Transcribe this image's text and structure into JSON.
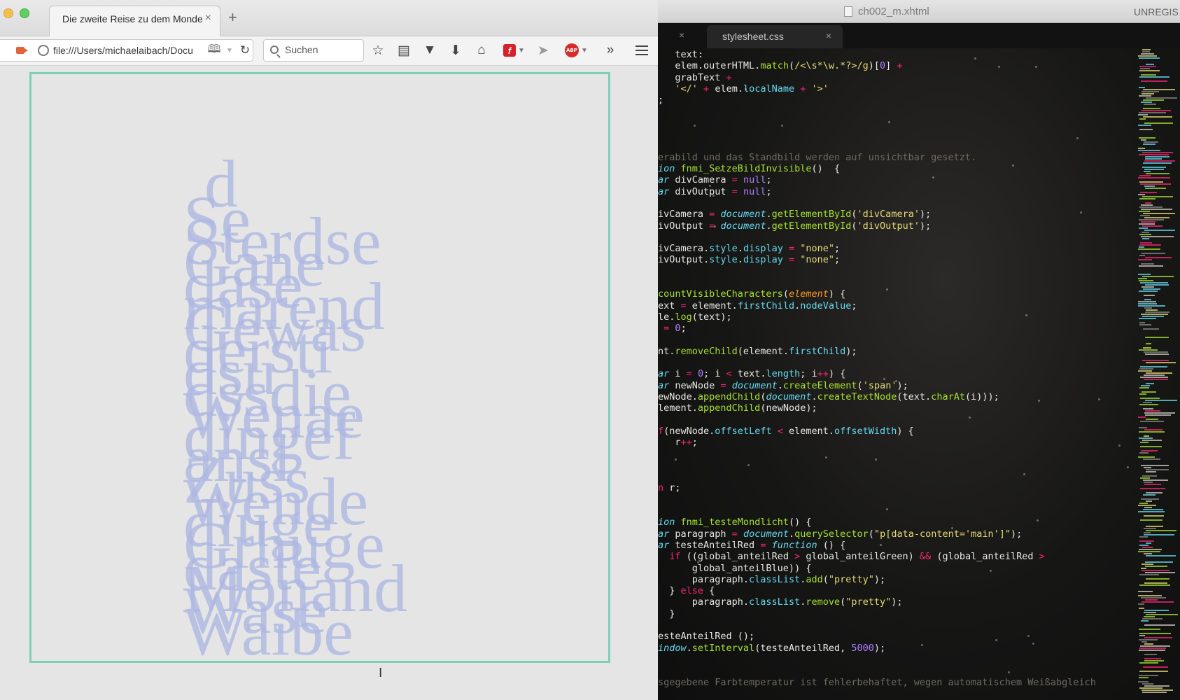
{
  "browser": {
    "tab_title": "Die zweite Reise zu dem Monde",
    "tab_close": "×",
    "new_tab": "+",
    "url": "file:///Users/michaelaibach/Docu",
    "search_placeholder": "Suchen",
    "toolbar_more": "»",
    "flash_letter": "f",
    "abp_label": "ABP",
    "text_cursor": "I"
  },
  "page": {
    "words": [
      "d",
      "Se",
      "Sterdse",
      "Gane",
      "dase",
      "marend",
      "Gewas",
      "dersti",
      "dsu",
      "dssdie",
      "Wenae",
      "dingef",
      "ansl",
      "Zuss",
      "Wende",
      "diuge",
      "Grhuge",
      "daste",
      "Monand",
      "Wase",
      "Waibe"
    ],
    "accent_color": "#7fcfb8",
    "text_color": "#adb7e2"
  },
  "editor": {
    "window_title": "ch002_m.xhtml",
    "unregistered": "UNREGIS",
    "tab_close_first": "×",
    "tab_title": "stylesheet.css",
    "tab_close": "×",
    "code_lines": [
      [
        {
          "t": "c-pl",
          "s": "   text:"
        }
      ],
      [
        {
          "t": "c-pl",
          "s": "   elem.outerHTML."
        },
        {
          "t": "c-fn",
          "s": "match"
        },
        {
          "t": "c-pl",
          "s": "("
        },
        {
          "t": "c-str",
          "s": "/<\\s*\\w.*?>/g"
        },
        {
          "t": "c-pl",
          "s": ")["
        },
        {
          "t": "c-num",
          "s": "0"
        },
        {
          "t": "c-pl",
          "s": "] "
        },
        {
          "t": "c-op",
          "s": "+"
        }
      ],
      [
        {
          "t": "c-pl",
          "s": "   grabText "
        },
        {
          "t": "c-op",
          "s": "+"
        }
      ],
      [
        {
          "t": "c-pl",
          "s": "   "
        },
        {
          "t": "c-str",
          "s": "'</'"
        },
        {
          "t": "c-pl",
          "s": " "
        },
        {
          "t": "c-op",
          "s": "+"
        },
        {
          "t": "c-pl",
          "s": " elem."
        },
        {
          "t": "c-prop",
          "s": "localName"
        },
        {
          "t": "c-pl",
          "s": " "
        },
        {
          "t": "c-op",
          "s": "+"
        },
        {
          "t": "c-pl",
          "s": " "
        },
        {
          "t": "c-str",
          "s": "'>'"
        }
      ],
      [
        {
          "t": "c-pl",
          "s": ";"
        }
      ],
      [
        {
          "t": "c-pl",
          "s": ""
        }
      ],
      [
        {
          "t": "c-pl",
          "s": ""
        }
      ],
      [
        {
          "t": "c-pl",
          "s": ""
        }
      ],
      [
        {
          "t": "c-pl",
          "s": ""
        }
      ],
      [
        {
          "t": "c-com",
          "s": "erabild und das Standbild werden auf unsichtbar gesetzt."
        }
      ],
      [
        {
          "t": "c-kw",
          "s": "ion"
        },
        {
          "t": "c-pl",
          "s": " "
        },
        {
          "t": "c-fn",
          "s": "fnmi_SetzeBildInvisible"
        },
        {
          "t": "c-pl",
          "s": "()  {"
        }
      ],
      [
        {
          "t": "c-kw",
          "s": "ar"
        },
        {
          "t": "c-pl",
          "s": " divCamera "
        },
        {
          "t": "c-op",
          "s": "="
        },
        {
          "t": "c-pl",
          "s": " "
        },
        {
          "t": "c-num",
          "s": "null"
        },
        {
          "t": "c-pl",
          "s": ";"
        }
      ],
      [
        {
          "t": "c-kw",
          "s": "ar"
        },
        {
          "t": "c-pl",
          "s": " divOutput "
        },
        {
          "t": "c-op",
          "s": "="
        },
        {
          "t": "c-pl",
          "s": " "
        },
        {
          "t": "c-num",
          "s": "null"
        },
        {
          "t": "c-pl",
          "s": ";"
        }
      ],
      [
        {
          "t": "c-pl",
          "s": ""
        }
      ],
      [
        {
          "t": "c-pl",
          "s": "ivCamera "
        },
        {
          "t": "c-op",
          "s": "="
        },
        {
          "t": "c-pl",
          "s": " "
        },
        {
          "t": "c-kw",
          "s": "document"
        },
        {
          "t": "c-pl",
          "s": "."
        },
        {
          "t": "c-fn",
          "s": "getElementById"
        },
        {
          "t": "c-pl",
          "s": "("
        },
        {
          "t": "c-str",
          "s": "'divCamera'"
        },
        {
          "t": "c-pl",
          "s": ");"
        }
      ],
      [
        {
          "t": "c-pl",
          "s": "ivOutput "
        },
        {
          "t": "c-op",
          "s": "="
        },
        {
          "t": "c-pl",
          "s": " "
        },
        {
          "t": "c-kw",
          "s": "document"
        },
        {
          "t": "c-pl",
          "s": "."
        },
        {
          "t": "c-fn",
          "s": "getElementById"
        },
        {
          "t": "c-pl",
          "s": "("
        },
        {
          "t": "c-str",
          "s": "'divOutput'"
        },
        {
          "t": "c-pl",
          "s": ");"
        }
      ],
      [
        {
          "t": "c-pl",
          "s": ""
        }
      ],
      [
        {
          "t": "c-pl",
          "s": "ivCamera."
        },
        {
          "t": "c-prop",
          "s": "style"
        },
        {
          "t": "c-pl",
          "s": "."
        },
        {
          "t": "c-prop",
          "s": "display"
        },
        {
          "t": "c-pl",
          "s": " "
        },
        {
          "t": "c-op",
          "s": "="
        },
        {
          "t": "c-pl",
          "s": " "
        },
        {
          "t": "c-str",
          "s": "\"none\""
        },
        {
          "t": "c-pl",
          "s": ";"
        }
      ],
      [
        {
          "t": "c-pl",
          "s": "ivOutput."
        },
        {
          "t": "c-prop",
          "s": "style"
        },
        {
          "t": "c-pl",
          "s": "."
        },
        {
          "t": "c-prop",
          "s": "display"
        },
        {
          "t": "c-pl",
          "s": " "
        },
        {
          "t": "c-op",
          "s": "="
        },
        {
          "t": "c-pl",
          "s": " "
        },
        {
          "t": "c-str",
          "s": "\"none\""
        },
        {
          "t": "c-pl",
          "s": ";"
        }
      ],
      [
        {
          "t": "c-pl",
          "s": ""
        }
      ],
      [
        {
          "t": "c-pl",
          "s": ""
        }
      ],
      [
        {
          "t": "c-fn",
          "s": "countVisibleCharacters"
        },
        {
          "t": "c-pl",
          "s": "("
        },
        {
          "t": "c-arg",
          "s": "element"
        },
        {
          "t": "c-pl",
          "s": ") {"
        }
      ],
      [
        {
          "t": "c-pl",
          "s": "ext "
        },
        {
          "t": "c-op",
          "s": "="
        },
        {
          "t": "c-pl",
          "s": " element."
        },
        {
          "t": "c-prop",
          "s": "firstChild"
        },
        {
          "t": "c-pl",
          "s": "."
        },
        {
          "t": "c-prop",
          "s": "nodeValue"
        },
        {
          "t": "c-pl",
          "s": ";"
        }
      ],
      [
        {
          "t": "c-pl",
          "s": "le."
        },
        {
          "t": "c-fn",
          "s": "log"
        },
        {
          "t": "c-pl",
          "s": "(text);"
        }
      ],
      [
        {
          "t": "c-pl",
          "s": " "
        },
        {
          "t": "c-op",
          "s": "="
        },
        {
          "t": "c-pl",
          "s": " "
        },
        {
          "t": "c-num",
          "s": "0"
        },
        {
          "t": "c-pl",
          "s": ";"
        }
      ],
      [
        {
          "t": "c-pl",
          "s": ""
        }
      ],
      [
        {
          "t": "c-pl",
          "s": "nt."
        },
        {
          "t": "c-fn",
          "s": "removeChild"
        },
        {
          "t": "c-pl",
          "s": "(element."
        },
        {
          "t": "c-prop",
          "s": "firstChild"
        },
        {
          "t": "c-pl",
          "s": ");"
        }
      ],
      [
        {
          "t": "c-pl",
          "s": ""
        }
      ],
      [
        {
          "t": "c-kw",
          "s": "ar"
        },
        {
          "t": "c-pl",
          "s": " i "
        },
        {
          "t": "c-op",
          "s": "="
        },
        {
          "t": "c-pl",
          "s": " "
        },
        {
          "t": "c-num",
          "s": "0"
        },
        {
          "t": "c-pl",
          "s": "; i "
        },
        {
          "t": "c-op",
          "s": "<"
        },
        {
          "t": "c-pl",
          "s": " text."
        },
        {
          "t": "c-prop",
          "s": "length"
        },
        {
          "t": "c-pl",
          "s": "; i"
        },
        {
          "t": "c-op",
          "s": "++"
        },
        {
          "t": "c-pl",
          "s": ") {"
        }
      ],
      [
        {
          "t": "c-kw",
          "s": "ar"
        },
        {
          "t": "c-pl",
          "s": " newNode "
        },
        {
          "t": "c-op",
          "s": "="
        },
        {
          "t": "c-pl",
          "s": " "
        },
        {
          "t": "c-kw",
          "s": "document"
        },
        {
          "t": "c-pl",
          "s": "."
        },
        {
          "t": "c-fn",
          "s": "createElement"
        },
        {
          "t": "c-pl",
          "s": "("
        },
        {
          "t": "c-str",
          "s": "'span'"
        },
        {
          "t": "c-pl",
          "s": ");"
        }
      ],
      [
        {
          "t": "c-pl",
          "s": "ewNode."
        },
        {
          "t": "c-fn",
          "s": "appendChild"
        },
        {
          "t": "c-pl",
          "s": "("
        },
        {
          "t": "c-kw",
          "s": "document"
        },
        {
          "t": "c-pl",
          "s": "."
        },
        {
          "t": "c-fn",
          "s": "createTextNode"
        },
        {
          "t": "c-pl",
          "s": "(text."
        },
        {
          "t": "c-fn",
          "s": "charAt"
        },
        {
          "t": "c-pl",
          "s": "(i)));"
        }
      ],
      [
        {
          "t": "c-pl",
          "s": "lement."
        },
        {
          "t": "c-fn",
          "s": "appendChild"
        },
        {
          "t": "c-pl",
          "s": "(newNode);"
        }
      ],
      [
        {
          "t": "c-pl",
          "s": ""
        }
      ],
      [
        {
          "t": "c-op",
          "s": "f"
        },
        {
          "t": "c-pl",
          "s": "(newNode."
        },
        {
          "t": "c-prop",
          "s": "offsetLeft"
        },
        {
          "t": "c-pl",
          "s": " "
        },
        {
          "t": "c-op",
          "s": "<"
        },
        {
          "t": "c-pl",
          "s": " element."
        },
        {
          "t": "c-prop",
          "s": "offsetWidth"
        },
        {
          "t": "c-pl",
          "s": ") {"
        }
      ],
      [
        {
          "t": "c-pl",
          "s": "   r"
        },
        {
          "t": "c-op",
          "s": "++"
        },
        {
          "t": "c-pl",
          "s": ";"
        }
      ],
      [
        {
          "t": "c-pl",
          "s": ""
        }
      ],
      [
        {
          "t": "c-pl",
          "s": ""
        }
      ],
      [
        {
          "t": "c-pl",
          "s": ""
        }
      ],
      [
        {
          "t": "c-op",
          "s": "n"
        },
        {
          "t": "c-pl",
          "s": " r;"
        }
      ],
      [
        {
          "t": "c-pl",
          "s": ""
        }
      ],
      [
        {
          "t": "c-pl",
          "s": ""
        }
      ],
      [
        {
          "t": "c-kw",
          "s": "ion"
        },
        {
          "t": "c-pl",
          "s": " "
        },
        {
          "t": "c-fn",
          "s": "fnmi_testeMondlicht"
        },
        {
          "t": "c-pl",
          "s": "() {"
        }
      ],
      [
        {
          "t": "c-kw",
          "s": "ar"
        },
        {
          "t": "c-pl",
          "s": " paragraph "
        },
        {
          "t": "c-op",
          "s": "="
        },
        {
          "t": "c-pl",
          "s": " "
        },
        {
          "t": "c-kw",
          "s": "document"
        },
        {
          "t": "c-pl",
          "s": "."
        },
        {
          "t": "c-fn",
          "s": "querySelector"
        },
        {
          "t": "c-pl",
          "s": "("
        },
        {
          "t": "c-str",
          "s": "\"p[data-content='main']\""
        },
        {
          "t": "c-pl",
          "s": ");"
        }
      ],
      [
        {
          "t": "c-kw",
          "s": "ar"
        },
        {
          "t": "c-pl",
          "s": " testeAnteilRed "
        },
        {
          "t": "c-op",
          "s": "="
        },
        {
          "t": "c-pl",
          "s": " "
        },
        {
          "t": "c-kw",
          "s": "function"
        },
        {
          "t": "c-pl",
          "s": " () {"
        }
      ],
      [
        {
          "t": "c-pl",
          "s": "  "
        },
        {
          "t": "c-op",
          "s": "if"
        },
        {
          "t": "c-pl",
          "s": " ((global_anteilRed "
        },
        {
          "t": "c-op",
          "s": ">"
        },
        {
          "t": "c-pl",
          "s": " global_anteilGreen) "
        },
        {
          "t": "c-op",
          "s": "&&"
        },
        {
          "t": "c-pl",
          "s": " (global_anteilRed "
        },
        {
          "t": "c-op",
          "s": ">"
        }
      ],
      [
        {
          "t": "c-pl",
          "s": "      global_anteilBlue)) {"
        }
      ],
      [
        {
          "t": "c-pl",
          "s": "      paragraph."
        },
        {
          "t": "c-prop",
          "s": "classList"
        },
        {
          "t": "c-pl",
          "s": "."
        },
        {
          "t": "c-fn",
          "s": "add"
        },
        {
          "t": "c-pl",
          "s": "("
        },
        {
          "t": "c-str",
          "s": "\"pretty\""
        },
        {
          "t": "c-pl",
          "s": ");"
        }
      ],
      [
        {
          "t": "c-pl",
          "s": "  } "
        },
        {
          "t": "c-op",
          "s": "else"
        },
        {
          "t": "c-pl",
          "s": " {"
        }
      ],
      [
        {
          "t": "c-pl",
          "s": "      paragraph."
        },
        {
          "t": "c-prop",
          "s": "classList"
        },
        {
          "t": "c-pl",
          "s": "."
        },
        {
          "t": "c-fn",
          "s": "remove"
        },
        {
          "t": "c-pl",
          "s": "("
        },
        {
          "t": "c-str",
          "s": "\"pretty\""
        },
        {
          "t": "c-pl",
          "s": ");"
        }
      ],
      [
        {
          "t": "c-pl",
          "s": "  }"
        }
      ],
      [
        {
          "t": "c-pl",
          "s": ""
        }
      ],
      [
        {
          "t": "c-pl",
          "s": "esteAnteilRed ();"
        }
      ],
      [
        {
          "t": "c-kw",
          "s": "indow"
        },
        {
          "t": "c-pl",
          "s": "."
        },
        {
          "t": "c-fn",
          "s": "setInterval"
        },
        {
          "t": "c-pl",
          "s": "(testeAnteilRed, "
        },
        {
          "t": "c-num",
          "s": "5000"
        },
        {
          "t": "c-pl",
          "s": ");"
        }
      ],
      [
        {
          "t": "c-pl",
          "s": ""
        }
      ],
      [
        {
          "t": "c-pl",
          "s": ""
        }
      ],
      [
        {
          "t": "c-com",
          "s": "sgegebene Farbtemperatur ist fehlerbehaftet, wegen automatischem Weißabgleich"
        }
      ]
    ]
  }
}
